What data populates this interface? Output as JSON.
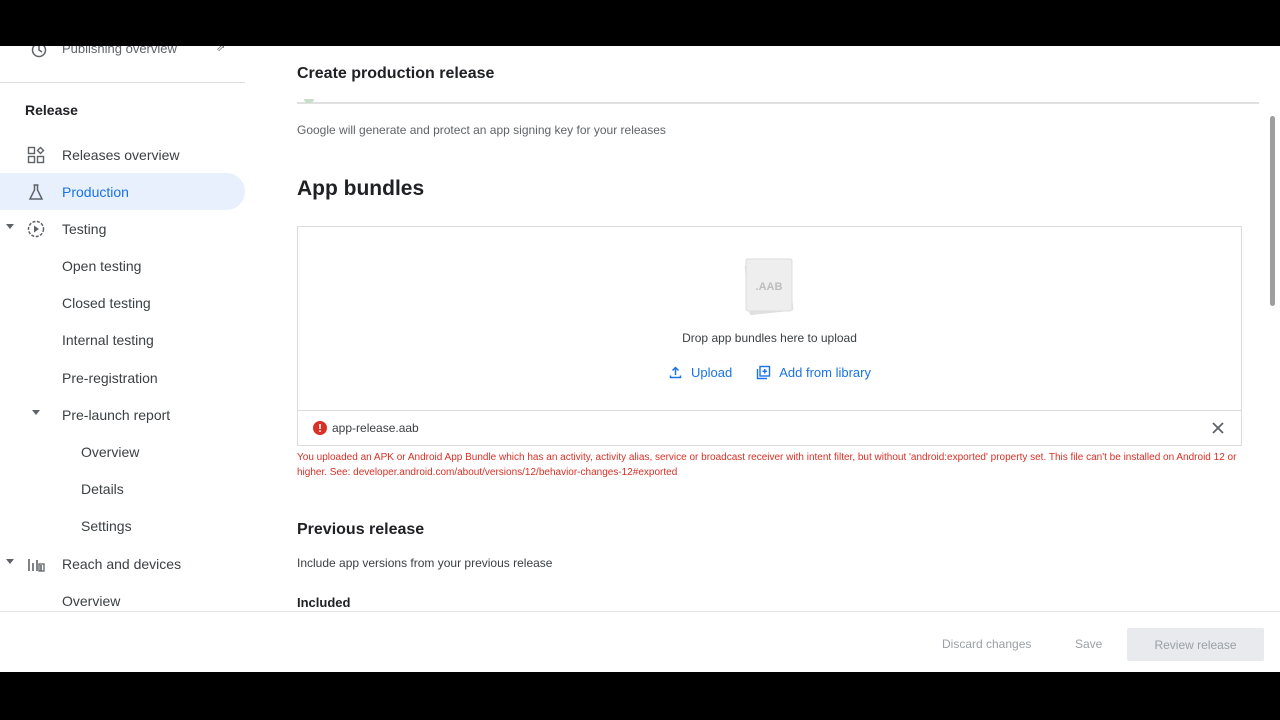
{
  "sidebar": {
    "top_item": "Publishing overview",
    "section_title": "Release",
    "items": [
      {
        "label": "Releases overview"
      },
      {
        "label": "Production"
      },
      {
        "label": "Testing"
      },
      {
        "label": "Open testing"
      },
      {
        "label": "Closed testing"
      },
      {
        "label": "Internal testing"
      },
      {
        "label": "Pre-registration"
      },
      {
        "label": "Pre-launch report"
      },
      {
        "label": "Overview"
      },
      {
        "label": "Details"
      },
      {
        "label": "Settings"
      },
      {
        "label": "Reach and devices"
      },
      {
        "label": "Overview"
      }
    ]
  },
  "main": {
    "title": "Create production release",
    "signing_text": "Google will generate and protect an app signing key for your releases",
    "app_bundles": {
      "heading": "App bundles",
      "icon_label": ".AAB",
      "drop_text": "Drop app bundles here to upload",
      "upload_label": "Upload",
      "add_library_label": "Add from library"
    },
    "file": {
      "name": "app-release.aab",
      "error": "You uploaded an APK or Android App Bundle which has an activity, activity alias, service or broadcast receiver with intent filter, but without 'android:exported' property set. This file can't be installed on Android 12 or higher. See: developer.android.com/about/versions/12/behavior-changes-12#exported"
    },
    "previous_release": {
      "heading": "Previous release",
      "subtitle": "Include app versions from your previous release",
      "included_label": "Included"
    }
  },
  "footer": {
    "discard_label": "Discard changes",
    "save_label": "Save",
    "review_label": "Review release"
  },
  "colors": {
    "accent": "#1a73e8",
    "active_bg": "#e8f0fe",
    "error": "#d93025",
    "disabled_text": "#9aa0a6"
  }
}
